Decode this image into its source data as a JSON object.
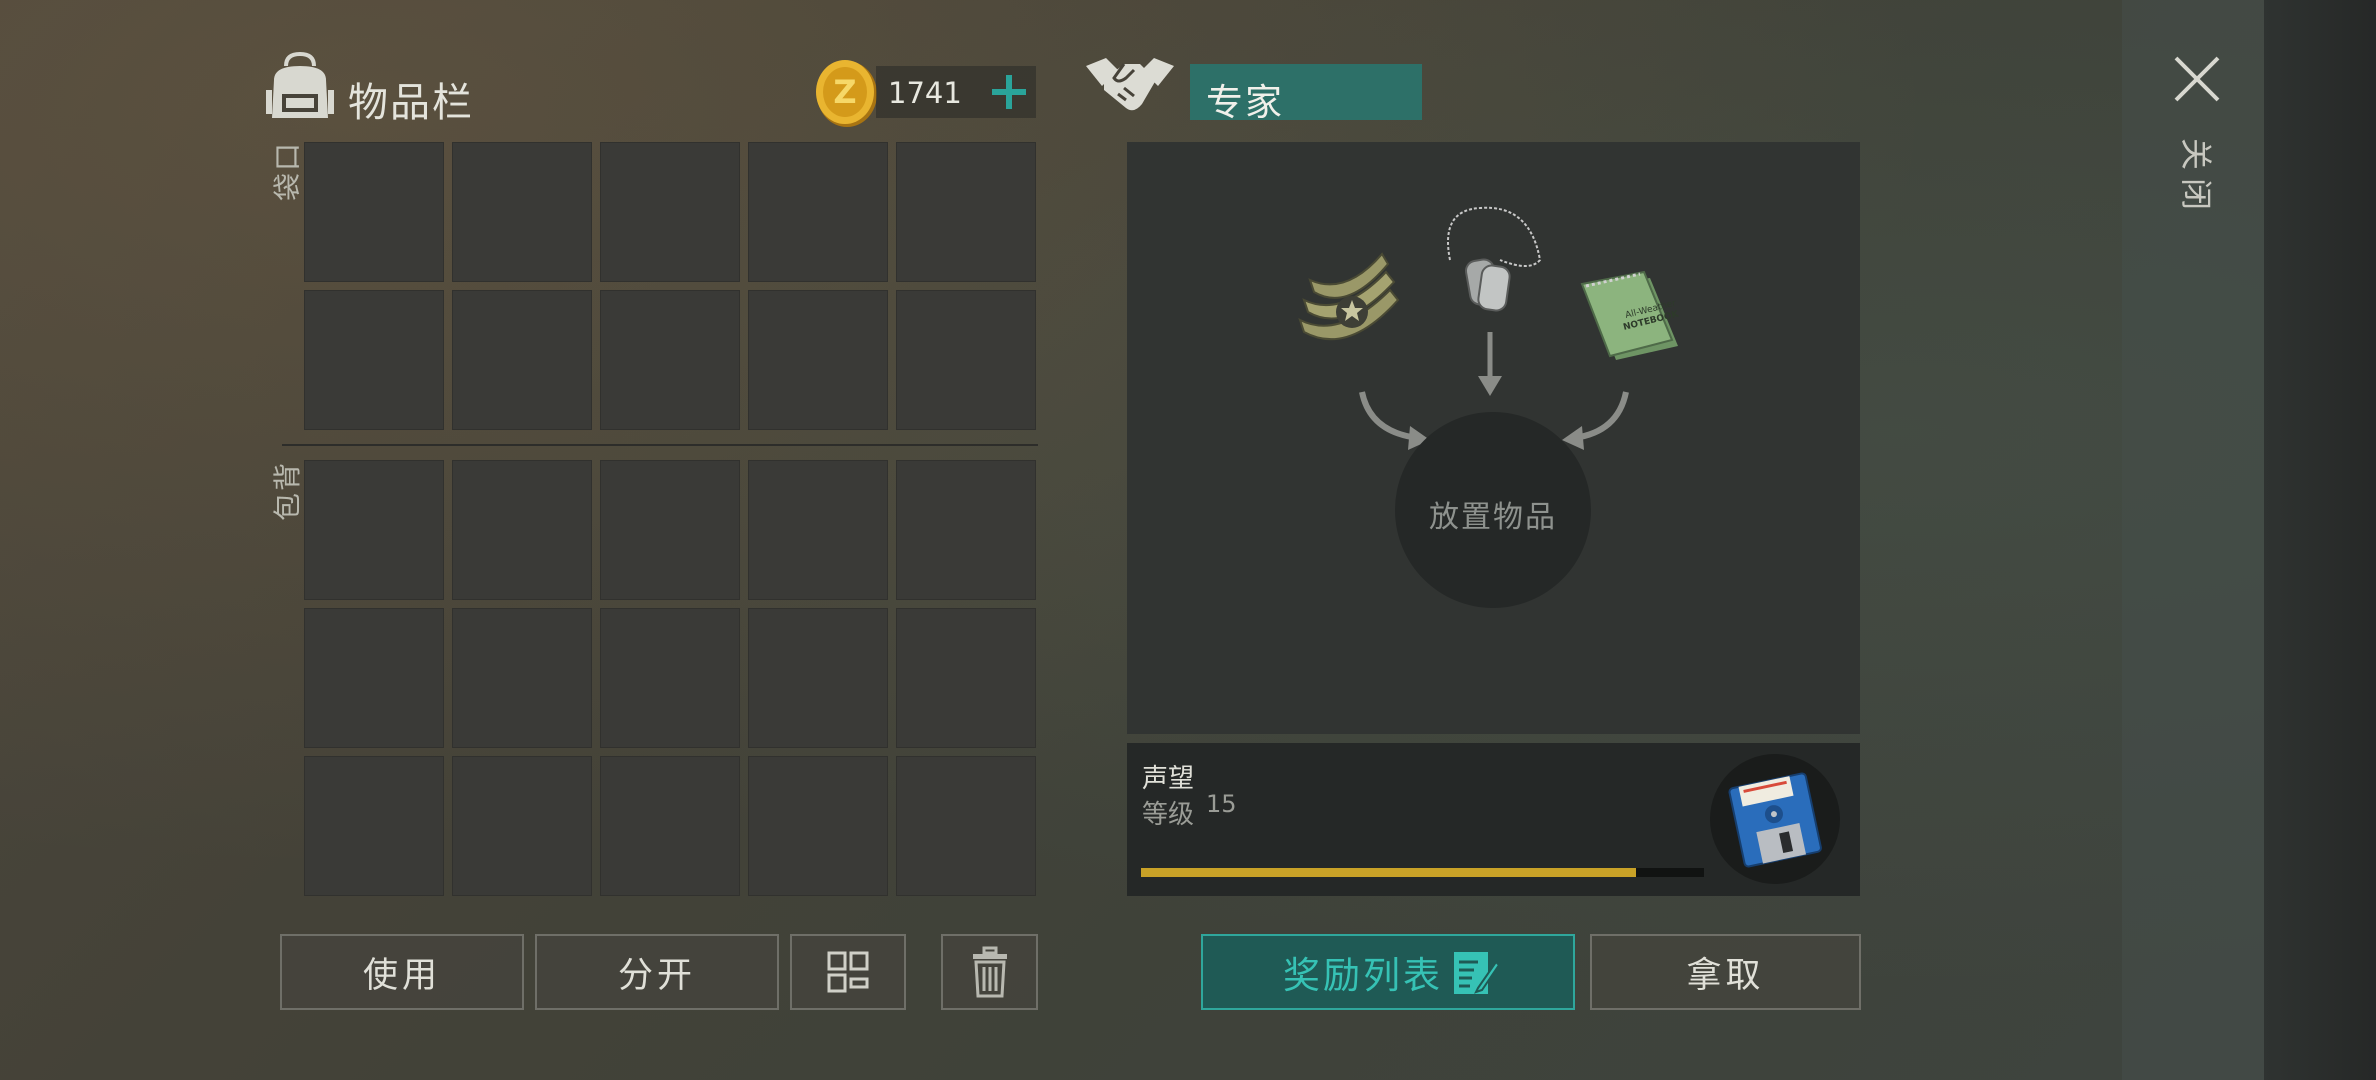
{
  "inventory": {
    "title": "物品栏",
    "pocket_label": [
      "口",
      "袋"
    ],
    "backpack_label": [
      "背",
      "包"
    ],
    "coins": "1741"
  },
  "actions": {
    "use": "使用",
    "split": "分开"
  },
  "expert": {
    "tab_label": "专家",
    "place_items": "放置物品",
    "reputation_title": "声望",
    "level_label": "等级",
    "level_value": "15",
    "progress": 0.88,
    "reward_list": "奖励列表",
    "take": "拿取"
  },
  "close": {
    "label": [
      "关",
      "闭"
    ]
  },
  "colors": {
    "accent": "#2aa49a",
    "progress": "#c9a227"
  },
  "icons": [
    "backpack-icon",
    "coin-icon",
    "plus-icon",
    "handshake-icon",
    "chevron-insignia-icon",
    "dog-tags-icon",
    "notebook-icon",
    "floppy-disk-icon",
    "grid-sort-icon",
    "trash-icon",
    "reward-list-icon",
    "close-icon"
  ]
}
